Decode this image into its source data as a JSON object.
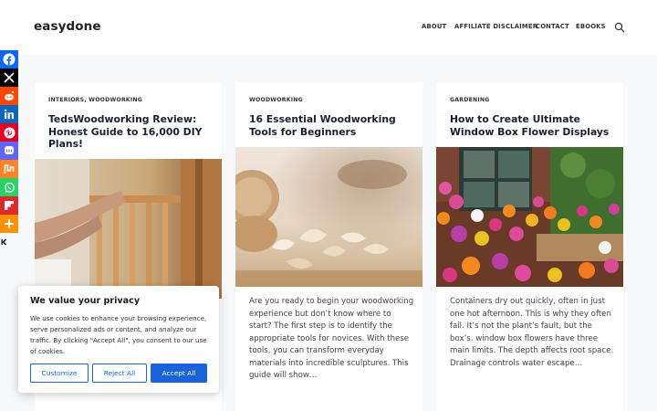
{
  "site": {
    "logo": "easydone"
  },
  "nav": {
    "items": [
      "ABOUT",
      "AFFILIATE DISCLAIMER",
      "CONTACT",
      "EBOOKS"
    ],
    "search_icon": "search-icon"
  },
  "posts": [
    {
      "category": "INTERIORS, WOODWORKING",
      "title": "TedsWoodworking Review: Honest Guide to 16,000 DIY Plans!",
      "excerpt": ""
    },
    {
      "category": "WOODWORKING",
      "title": "16 Essential Woodworking Tools for Beginners",
      "excerpt": "Are you ready to begin your woodworking experience but don’t know where to start? The first step is to identify the appropriate tools for novices. With these tools, you can transform everyday materials into incredible sculptures. This guide will show…"
    },
    {
      "category": "GARDENING",
      "title": "How to Create Ultimate Window Box Flower Displays",
      "excerpt": "Containers dry out quickly, often in just one hot afternoon. This is why they often fail. It’s not the plant’s fault, but the box’s. window box flowers have three main limits. The depth affects root space. Drainage controls water escape…"
    }
  ],
  "share": {
    "buttons": [
      {
        "name": "facebook",
        "icon": "facebook-icon",
        "color": "#0866ff"
      },
      {
        "name": "x",
        "icon": "x-icon",
        "color": "#000000"
      },
      {
        "name": "reddit",
        "icon": "reddit-icon",
        "color": "#ff4500"
      },
      {
        "name": "linkedin",
        "icon": "linkedin-icon",
        "color": "#0a66c2"
      },
      {
        "name": "pinterest",
        "icon": "pinterest-icon",
        "color": "#e60023"
      },
      {
        "name": "mastodon",
        "icon": "mastodon-icon",
        "color": "#6364ff"
      },
      {
        "name": "mix",
        "icon": "mix-icon",
        "color": "#ff8226"
      },
      {
        "name": "whatsapp",
        "icon": "whatsapp-icon",
        "color": "#25d366"
      },
      {
        "name": "flipboard",
        "icon": "flipboard-icon",
        "color": "#e12828"
      },
      {
        "name": "more",
        "icon": "plus-icon",
        "color": "#ff9000"
      }
    ],
    "toggle_icon": "hide-share-icon"
  },
  "cookie": {
    "title": "We value your privacy",
    "text": "We use cookies to enhance your browsing experience, serve personalized ads or content, and analyze our traffic. By clicking \"Accept All\", you consent to our use of cookies.",
    "customize": "Customize",
    "reject": "Reject All",
    "accept": "Accept All",
    "accent": "#1863dc"
  }
}
